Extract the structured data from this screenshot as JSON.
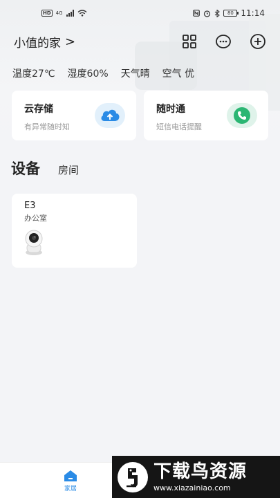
{
  "status_bar": {
    "network": "4G",
    "time": "11:14",
    "battery": "80"
  },
  "header": {
    "home_name": "小值的家",
    "chevron": ">"
  },
  "icons": {
    "grid": "grid-icon",
    "message": "message-icon",
    "add": "add-circle-icon"
  },
  "weather": {
    "temperature": "温度27℃",
    "humidity": "湿度60%",
    "condition": "天气晴",
    "air": "空气 优"
  },
  "services": [
    {
      "title": "云存储",
      "subtitle": "有异常随时知",
      "icon": "cloud-upload-icon",
      "color": "#2a8be6"
    },
    {
      "title": "随时通",
      "subtitle": "短信电话提醒",
      "icon": "phone-icon",
      "color": "#2bb673"
    }
  ],
  "tabs": {
    "active": "设备",
    "inactive": "房间"
  },
  "devices": [
    {
      "name": "E3",
      "room": "办公室",
      "icon": "camera-icon"
    }
  ],
  "bottom_nav": {
    "home_label": "家居",
    "accent": "#2a8be6"
  },
  "watermark": {
    "title": "下载鸟资源",
    "url": "www.xiazainiao.com"
  }
}
